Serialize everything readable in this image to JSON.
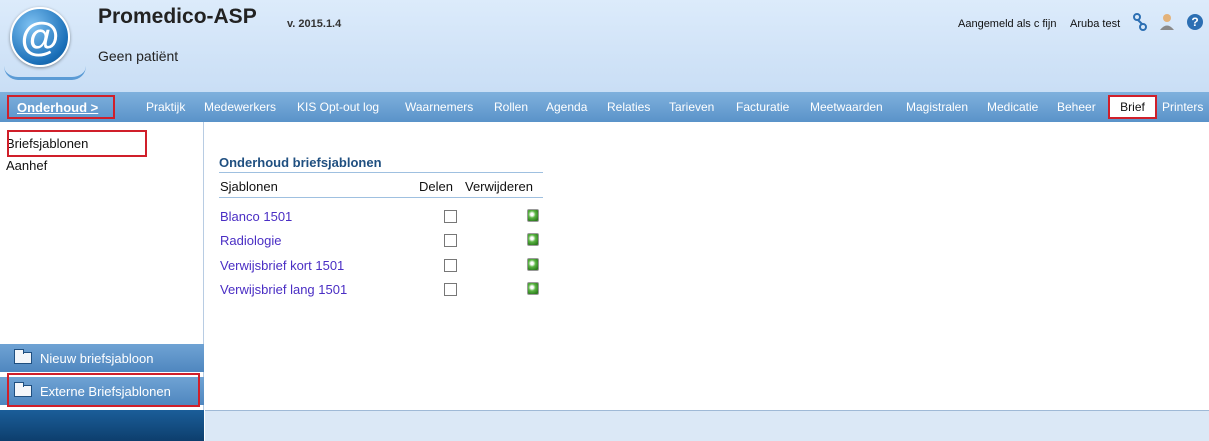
{
  "header": {
    "app_title": "Promedico-ASP",
    "version": "v. 2015.1.4",
    "patient": "Geen patiënt",
    "logged_in_label": "Aangemeld als c fijn",
    "user_name": "Aruba test",
    "icons": [
      "network-icon",
      "user-icon",
      "help-icon"
    ]
  },
  "nav": {
    "onderhoud": "Onderhoud >",
    "items": [
      "Praktijk",
      "Medewerkers",
      "KIS Opt-out log",
      "Waarnemers",
      "Rollen",
      "Agenda",
      "Relaties",
      "Tarieven",
      "Facturatie",
      "Meetwaarden",
      "Magistralen",
      "Medicatie",
      "Beheer"
    ],
    "brief": "Brief",
    "printers": "Printers"
  },
  "sidebar": {
    "items": [
      "Briefsjablonen",
      "Aanhef"
    ],
    "new_button": "Nieuw briefsjabloon",
    "external_button": "Externe Briefsjablonen"
  },
  "main": {
    "title": "Onderhoud briefsjablonen",
    "columns": {
      "name": "Sjablonen",
      "share": "Delen",
      "delete": "Verwijderen"
    },
    "rows": [
      {
        "name": "Blanco 1501",
        "shared": false
      },
      {
        "name": "Radiologie",
        "shared": false
      },
      {
        "name": "Verwijsbrief kort 1501",
        "shared": false
      },
      {
        "name": "Verwijsbrief lang 1501",
        "shared": false
      }
    ]
  },
  "colors": {
    "highlight": "#d01f2a",
    "nav": "#5a93c9",
    "link": "#4a2ec4"
  }
}
